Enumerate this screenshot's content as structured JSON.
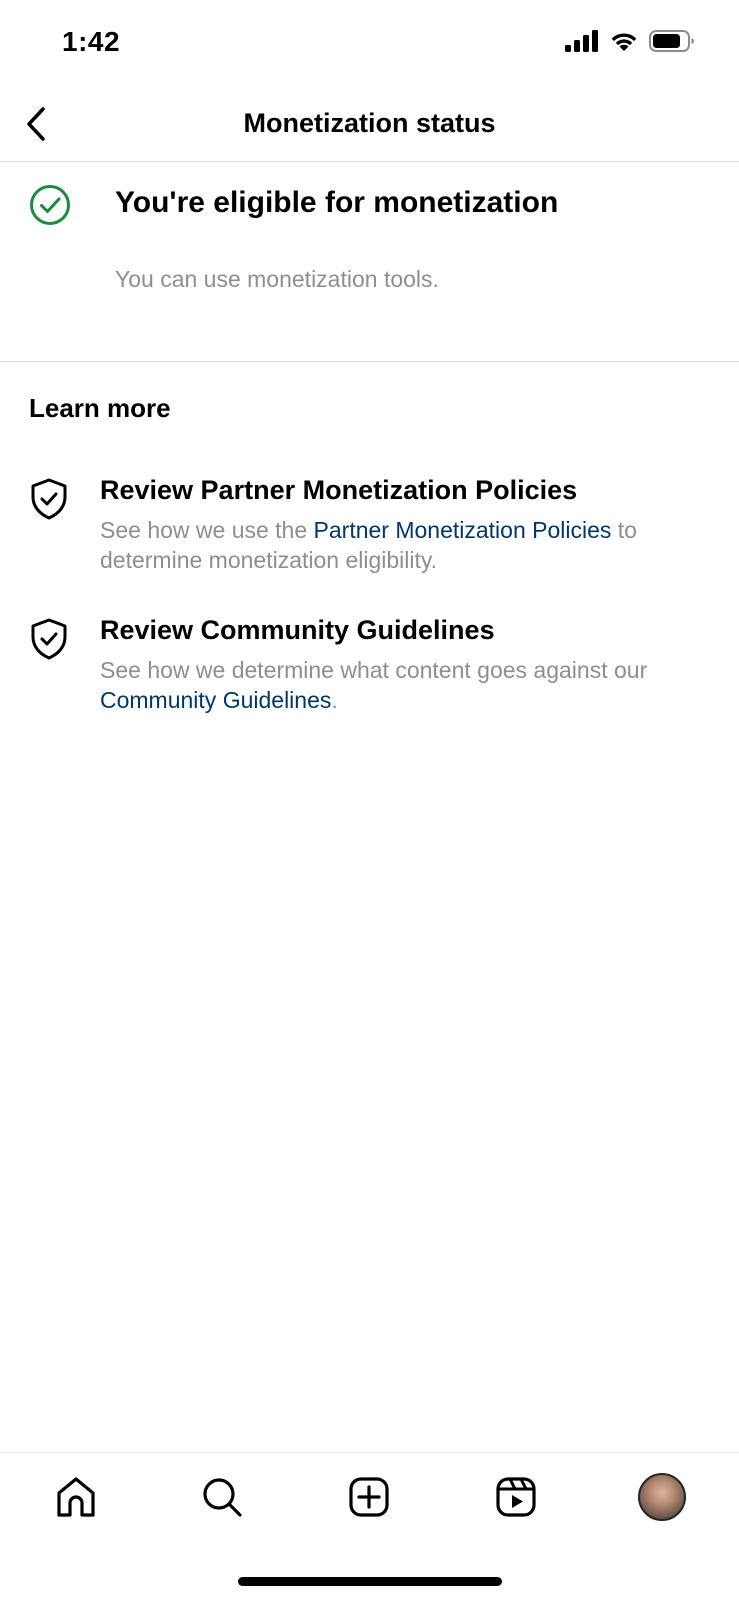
{
  "status_bar": {
    "time": "1:42"
  },
  "header": {
    "title": "Monetization status"
  },
  "eligibility": {
    "title": "You're eligible for monetization",
    "subtitle": "You can use monetization tools.",
    "status_color": "#1a8a3e"
  },
  "learn_more": {
    "title": "Learn more",
    "items": [
      {
        "title": "Review Partner Monetization Policies",
        "desc_before": "See how we use the ",
        "link": "Partner Monetization Policies",
        "desc_after": " to determine monetization eligibility."
      },
      {
        "title": "Review Community Guidelines",
        "desc_before": "See how we determine what content goes against our ",
        "link": "Community Guidelines",
        "desc_after": "."
      }
    ]
  },
  "nav": {
    "items": [
      "home-icon",
      "search-icon",
      "create-icon",
      "reels-icon",
      "profile-avatar"
    ]
  },
  "colors": {
    "link": "#00376b",
    "secondary_text": "#8e8e8e",
    "divider": "#e3e3e3"
  }
}
